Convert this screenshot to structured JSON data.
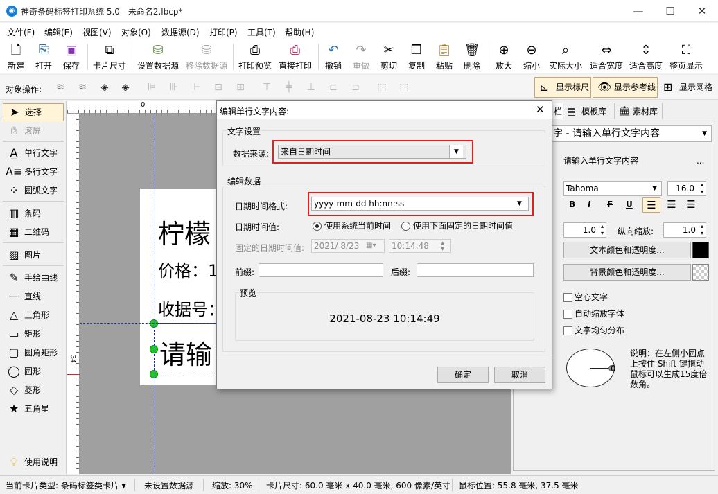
{
  "window": {
    "title": "神奇条码标签打印系统 5.0 - 未命名2.lbcp*",
    "app_icon": "app-logo-icon"
  },
  "menu": [
    "文件(F)",
    "编辑(E)",
    "视图(V)",
    "对象(O)",
    "数据源(D)",
    "打印(P)",
    "工具(T)",
    "帮助(H)"
  ],
  "toolbar": {
    "new": "新建",
    "open": "打开",
    "save": "保存",
    "card_size": "卡片尺寸",
    "set_datasource": "设置数据源",
    "remove_datasource": "移除数据源",
    "print_preview": "打印预览",
    "direct_print": "直接打印",
    "undo": "撤销",
    "redo": "重做",
    "cut": "剪切",
    "copy": "复制",
    "paste": "粘贴",
    "delete": "删除",
    "zoom_in": "放大",
    "zoom_out": "缩小",
    "actual_size": "实际大小",
    "fit_width": "适合宽度",
    "fit_height": "适合高度",
    "fit_page": "整页显示"
  },
  "objbar": {
    "label": "对象操作:",
    "show_ruler": "显示标尺",
    "show_guides": "显示参考线",
    "show_grid": "显示网格"
  },
  "tools": {
    "select": "选择",
    "scroll": "滚屏",
    "single_text": "单行文字",
    "multi_text": "多行文字",
    "arc_text": "圆弧文字",
    "barcode": "条码",
    "qrcode": "二维码",
    "image": "图片",
    "freehand": "手绘曲线",
    "line": "直线",
    "triangle": "三角形",
    "rectangle": "矩形",
    "rounded_rect": "圆角矩形",
    "circle": "圆形",
    "diamond": "菱形",
    "star": "五角星",
    "help": "使用说明"
  },
  "canvas": {
    "ruler_zero": "0",
    "ruler_v_mark": "34",
    "card_texts": {
      "line1": "柠檬",
      "line2": "价格：1",
      "line3": "收据号：",
      "line4": "请输"
    }
  },
  "right_panel": {
    "tabs": {
      "prop": "栏",
      "templates": "模板库",
      "materials": "素材库"
    },
    "object_combo": "字 - 请输入单行文字内容",
    "content_value": "请输入单行文字内容",
    "content_btn": "...",
    "font": "Tahoma",
    "font_size": "16.0",
    "bold": "B",
    "italic": "I",
    "strike": "F",
    "underline": "U",
    "hscale": "1.0",
    "vscale_label": "纵向缩放:",
    "vscale": "1.0",
    "text_color_btn": "文本颜色和透明度...",
    "bg_color_btn": "背景颜色和透明度...",
    "hollow": "空心文字",
    "autoshrink": "自动缩放字体",
    "distribute": "文字均匀分布",
    "angle": "0",
    "note": "说明：在左侧小圆点上按住 Shift 键拖动鼠标可以生成15度倍数角。",
    "text_color": "#000000"
  },
  "status": {
    "card_type": "当前卡片类型: 条码标签类卡片 ▾",
    "datasource": "未设置数据源",
    "zoom": "缩放: 30%",
    "card_size": "卡片尺寸: 60.0 毫米 x 40.0 毫米, 600 像素/英寸",
    "mouse_pos": "鼠标位置: 55.8 毫米, 37.5 毫米"
  },
  "dialog": {
    "title": "编辑单行文字内容:",
    "text_settings_group": "文字设置",
    "datasource_label": "数据来源:",
    "datasource_value": "来自日期时间",
    "edit_data_group": "编辑数据",
    "format_label": "日期时间格式:",
    "format_value": "yyyy-mm-dd hh:nn:ss",
    "value_label": "日期时间值:",
    "radio_current": "使用系统当前时间",
    "radio_fixed": "使用下面固定的日期时间值",
    "fixed_label": "固定的日期时间值:",
    "fixed_date": "2021/  8/23",
    "fixed_time": "10:14:48",
    "prefix_label": "前缀:",
    "prefix_value": "",
    "suffix_label": "后缀:",
    "suffix_value": "",
    "preview_group": "预览",
    "preview_text": "2021-08-23 10:14:49",
    "ok": "确定",
    "cancel": "取消",
    "highlight_color": "#e02020"
  }
}
